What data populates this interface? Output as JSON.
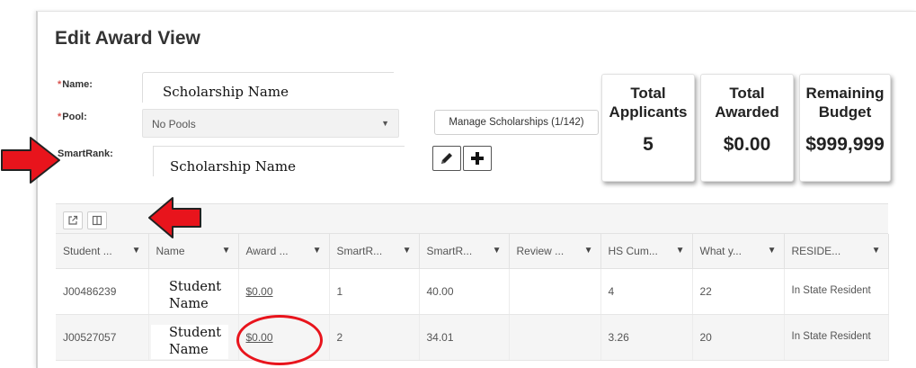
{
  "page": {
    "title": "Edit Award View"
  },
  "form": {
    "name_label": "Name:",
    "name_value": "Scholarship Name",
    "pool_label": "Pool:",
    "pool_value": "No Pools",
    "smartrank_label": "SmartRank:",
    "smartrank_value": "Scholarship Name",
    "manage_label": "Manage Scholarships (1/142)"
  },
  "stats": [
    {
      "label": "Total Applicants",
      "value": "5"
    },
    {
      "label": "Total Awarded",
      "value": "$0.00"
    },
    {
      "label": "Remaining Budget",
      "value": "$999,999"
    }
  ],
  "table": {
    "columns": [
      "Student ...",
      "Name",
      "Award ...",
      "SmartR...",
      "SmartR...",
      "Review ...",
      "HS Cum...",
      "What y...",
      "RESIDE..."
    ],
    "rows": [
      {
        "student_id": "J00486239",
        "name": "Student Name",
        "award": "$0.00",
        "smartrank": "1",
        "smartrank_score": "40.00",
        "review": "",
        "hs_cum": "4",
        "what": "22",
        "residency": "In State Resident"
      },
      {
        "student_id": "J00527057",
        "name": "Student Name",
        "award": "$0.00",
        "smartrank": "2",
        "smartrank_score": "34.01",
        "review": "",
        "hs_cum": "3.26",
        "what": "20",
        "residency": "In State Resident"
      }
    ]
  },
  "icons": {
    "pencil": "pencil-icon",
    "plus": "plus-icon",
    "export": "external-link-icon",
    "columns": "columns-icon",
    "filter": "filter-icon"
  },
  "colors": {
    "required": "#d9534f",
    "annotation": "#e8141c"
  }
}
